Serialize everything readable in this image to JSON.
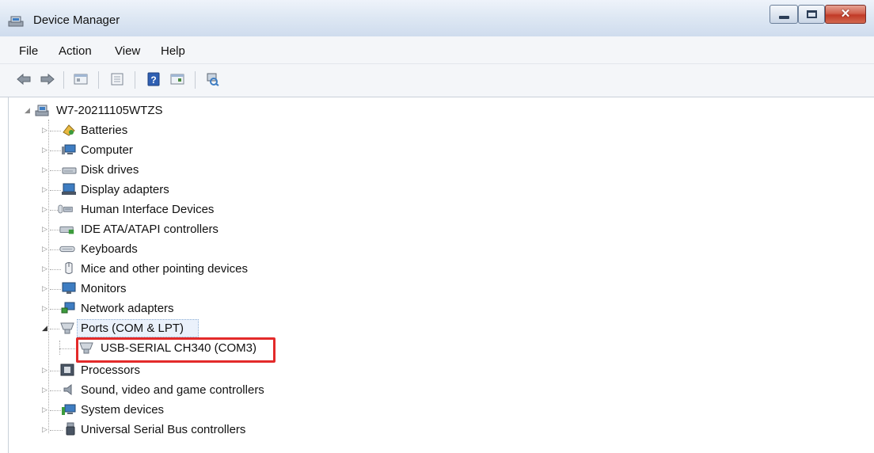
{
  "window": {
    "title": "Device Manager"
  },
  "menu": [
    "File",
    "Action",
    "View",
    "Help"
  ],
  "toolbar": {
    "buttons": [
      "back-icon",
      "forward-icon",
      "properties-icon",
      "show-hide-tree-icon",
      "help-icon",
      "details-icon",
      "scan-hardware-icon"
    ]
  },
  "tree": {
    "root": "W7-20211105WTZS",
    "items": [
      {
        "label": "Batteries",
        "icon": "battery-icon",
        "expanded": false
      },
      {
        "label": "Computer",
        "icon": "computer-icon",
        "expanded": false
      },
      {
        "label": "Disk drives",
        "icon": "disk-drive-icon",
        "expanded": false
      },
      {
        "label": "Display adapters",
        "icon": "display-adapter-icon",
        "expanded": false
      },
      {
        "label": "Human Interface Devices",
        "icon": "hid-icon",
        "expanded": false
      },
      {
        "label": "IDE ATA/ATAPI controllers",
        "icon": "ide-controller-icon",
        "expanded": false
      },
      {
        "label": "Keyboards",
        "icon": "keyboard-icon",
        "expanded": false
      },
      {
        "label": "Mice and other pointing devices",
        "icon": "mouse-icon",
        "expanded": false
      },
      {
        "label": "Monitors",
        "icon": "monitor-icon",
        "expanded": false
      },
      {
        "label": "Network adapters",
        "icon": "network-adapter-icon",
        "expanded": false
      },
      {
        "label": "Ports (COM & LPT)",
        "icon": "port-icon",
        "expanded": true,
        "children": [
          {
            "label": "USB-SERIAL CH340 (COM3)",
            "icon": "port-icon"
          }
        ]
      },
      {
        "label": "Processors",
        "icon": "processor-icon",
        "expanded": false
      },
      {
        "label": "Sound, video and game controllers",
        "icon": "sound-icon",
        "expanded": false
      },
      {
        "label": "System devices",
        "icon": "system-device-icon",
        "expanded": false
      },
      {
        "label": "Universal Serial Bus controllers",
        "icon": "usb-icon",
        "expanded": false
      }
    ]
  },
  "colors": {
    "highlight": "#e32a2a"
  }
}
